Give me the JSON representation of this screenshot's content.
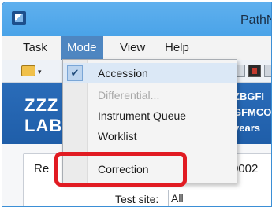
{
  "window": {
    "title": "PathN"
  },
  "menubar": [
    {
      "label": "Task"
    },
    {
      "label": "Mode"
    },
    {
      "label": "View"
    },
    {
      "label": "Help"
    }
  ],
  "toolbar": {
    "dropdown_glyph": "▾"
  },
  "banner": {
    "left_lines": [
      "ZZZ",
      "LAB"
    ],
    "right_lines": [
      "ZBGFI",
      "GFMCO",
      "years"
    ]
  },
  "form": {
    "row_label": "Re",
    "row_value": "0002",
    "test_site_label": "Test site:",
    "test_site_value": "All"
  },
  "mode_menu": {
    "items": [
      {
        "label": "Accession",
        "checked": true,
        "disabled": false
      },
      {
        "label": "Differential...",
        "checked": false,
        "disabled": true
      },
      {
        "label": "Instrument Queue",
        "checked": false,
        "disabled": false
      },
      {
        "label": "Worklist",
        "checked": false,
        "disabled": false
      },
      {
        "label": "Correction",
        "checked": false,
        "disabled": false
      }
    ],
    "check_glyph": "✔"
  },
  "colors": {
    "titlebar": "#4aa3e8",
    "banner": "#1f5ea9",
    "menu_active": "#4e86c1",
    "highlight": "#e11b22"
  }
}
